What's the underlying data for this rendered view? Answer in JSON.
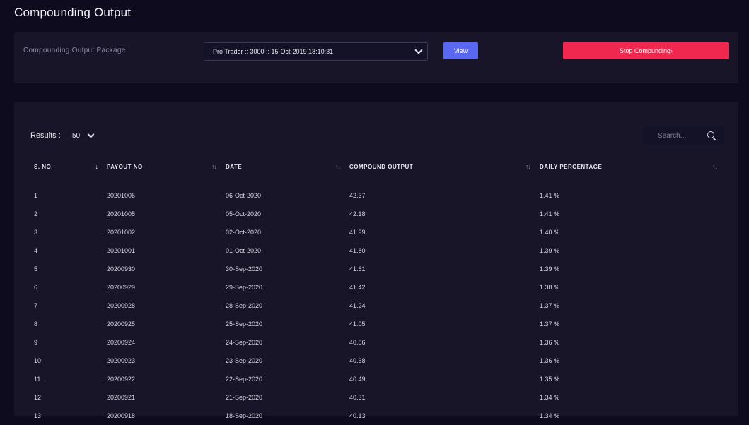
{
  "page": {
    "title": "Compounding Output"
  },
  "package": {
    "label": "Compounding Output Package",
    "selected": "Pro Trader :: 3000 :: 15-Oct-2019 18:10:31",
    "view_label": "View",
    "stop_label": "Stop Compunding›"
  },
  "results": {
    "label": "Results :",
    "page_size": "50",
    "search_placeholder": "Search..."
  },
  "table": {
    "columns": [
      "S. NO.",
      "PAYOUT NO",
      "DATE",
      "COMPOUND OUTPUT",
      "DAILY PERCENTAGE"
    ],
    "sort_icons": [
      "↓",
      "↑↓",
      "↑↓",
      "↑↓",
      "↑↓"
    ],
    "rows": [
      [
        "1",
        "20201006",
        "06-Oct-2020",
        "42.37",
        "1.41 %"
      ],
      [
        "2",
        "20201005",
        "05-Oct-2020",
        "42.18",
        "1.41 %"
      ],
      [
        "3",
        "20201002",
        "02-Oct-2020",
        "41.99",
        "1.40 %"
      ],
      [
        "4",
        "20201001",
        "01-Oct-2020",
        "41.80",
        "1.39 %"
      ],
      [
        "5",
        "20200930",
        "30-Sep-2020",
        "41.61",
        "1.39 %"
      ],
      [
        "6",
        "20200929",
        "29-Sep-2020",
        "41.42",
        "1.38 %"
      ],
      [
        "7",
        "20200928",
        "28-Sep-2020",
        "41.24",
        "1.37 %"
      ],
      [
        "8",
        "20200925",
        "25-Sep-2020",
        "41.05",
        "1.37 %"
      ],
      [
        "9",
        "20200924",
        "24-Sep-2020",
        "40.86",
        "1.36 %"
      ],
      [
        "10",
        "20200923",
        "23-Sep-2020",
        "40.68",
        "1.36 %"
      ],
      [
        "11",
        "20200922",
        "22-Sep-2020",
        "40.49",
        "1.35 %"
      ],
      [
        "12",
        "20200921",
        "21-Sep-2020",
        "40.31",
        "1.34 %"
      ],
      [
        "13",
        "20200918",
        "18-Sep-2020",
        "40.13",
        "1.34 %"
      ]
    ]
  },
  "colors": {
    "background": "#0f0b1e",
    "card": "#171527",
    "view_button": "#5a67f0",
    "stop_button": "#f0284f"
  }
}
